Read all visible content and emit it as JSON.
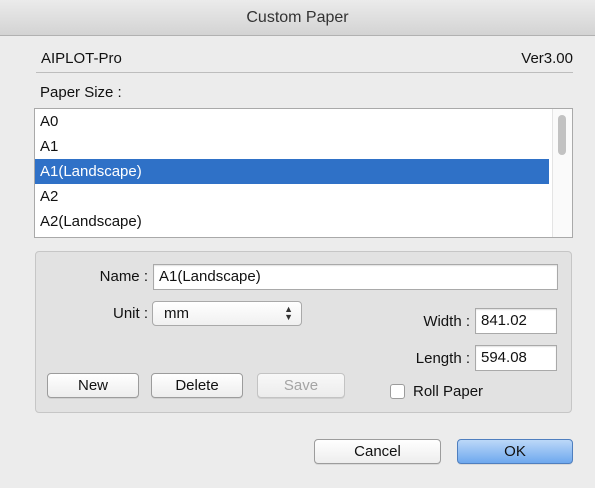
{
  "window": {
    "title": "Custom Paper"
  },
  "header": {
    "app_name": "AIPLOT-Pro",
    "version": "Ver3.00"
  },
  "paper_size": {
    "label": "Paper Size :",
    "items": [
      {
        "label": "A0"
      },
      {
        "label": "A1"
      },
      {
        "label": "A1(Landscape)",
        "selected": true
      },
      {
        "label": "A2"
      },
      {
        "label": "A2(Landscape)"
      }
    ]
  },
  "form": {
    "name_label": "Name :",
    "name_value": "A1(Landscape)",
    "unit_label": "Unit :",
    "unit_value": "mm",
    "width_label": "Width :",
    "width_value": "841.02",
    "length_label": "Length :",
    "length_value": "594.08",
    "roll_paper_label": "Roll Paper",
    "roll_paper_checked": false
  },
  "buttons": {
    "new": "New",
    "delete": "Delete",
    "save": "Save",
    "cancel": "Cancel",
    "ok": "OK"
  },
  "colors": {
    "selection": "#2f71c7",
    "default_button": "#6ea8ee"
  }
}
